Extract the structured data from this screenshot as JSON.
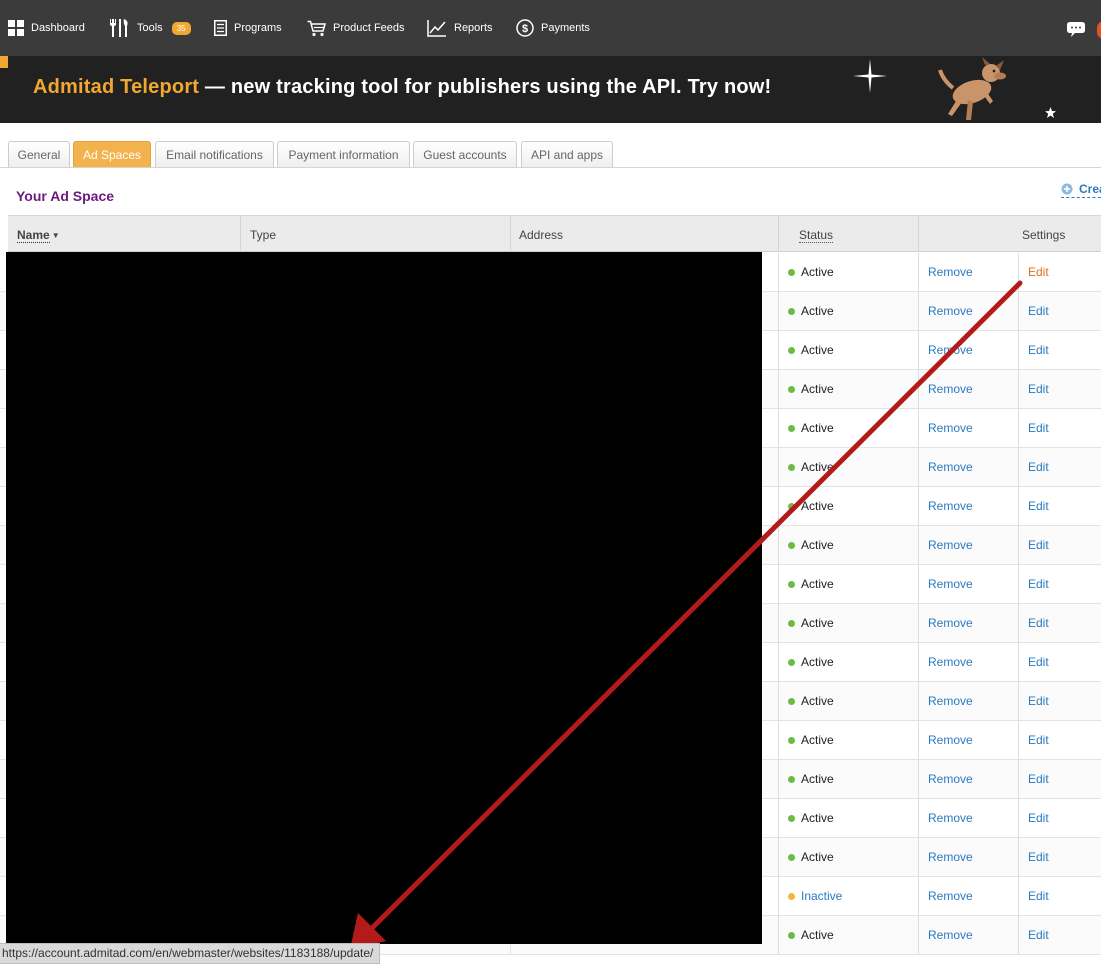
{
  "nav": {
    "items": [
      {
        "label": "Dashboard",
        "icon": "grid-icon"
      },
      {
        "label": "Tools",
        "icon": "tools-icon",
        "badge": "35"
      },
      {
        "label": "Programs",
        "icon": "document-list-icon"
      },
      {
        "label": "Product Feeds",
        "icon": "cart-icon"
      },
      {
        "label": "Reports",
        "icon": "chart-line-icon"
      },
      {
        "label": "Payments",
        "icon": "dollar-circle-icon"
      }
    ],
    "right_icons": [
      "chat-bubbles-icon"
    ]
  },
  "banner": {
    "brand": "Admitad Teleport",
    "text": " — new tracking tool for publishers using the API. Try now!"
  },
  "tabs": [
    {
      "label": "General",
      "active": false
    },
    {
      "label": "Ad Spaces",
      "active": true
    },
    {
      "label": "Email notifications",
      "active": false
    },
    {
      "label": "Payment information",
      "active": false
    },
    {
      "label": "Guest accounts",
      "active": false
    },
    {
      "label": "API and apps",
      "active": false
    }
  ],
  "section": {
    "title": "Your Ad Space",
    "create_label": "Crea"
  },
  "table": {
    "headers": {
      "name": "Name",
      "type": "Type",
      "address": "Address",
      "status": "Status",
      "settings": "Settings"
    },
    "remove_label": "Remove",
    "edit_label": "Edit",
    "rows": [
      {
        "status": "Active"
      },
      {
        "status": "Active"
      },
      {
        "status": "Active"
      },
      {
        "status": "Active"
      },
      {
        "status": "Active"
      },
      {
        "status": "Active"
      },
      {
        "status": "Active"
      },
      {
        "status": "Active"
      },
      {
        "status": "Active"
      },
      {
        "status": "Active"
      },
      {
        "status": "Active"
      },
      {
        "status": "Active"
      },
      {
        "status": "Active"
      },
      {
        "status": "Active"
      },
      {
        "status": "Active"
      },
      {
        "status": "Active"
      },
      {
        "status": "Inactive"
      },
      {
        "status": "Active"
      }
    ]
  },
  "colors": {
    "nav_bg": "#3b3b3b",
    "banner_bg": "#212121",
    "accent_orange": "#f0a830",
    "title_purple": "#6a1b7d",
    "link_blue": "#2a7ac0",
    "hover_orange": "#e0701c",
    "status_active": "#6dbb3f",
    "status_inactive": "#f0b73a",
    "arrow_red": "#b31b1b"
  },
  "status_bar": {
    "url": "https://account.admitad.com/en/webmaster/websites/1183188/update/"
  }
}
